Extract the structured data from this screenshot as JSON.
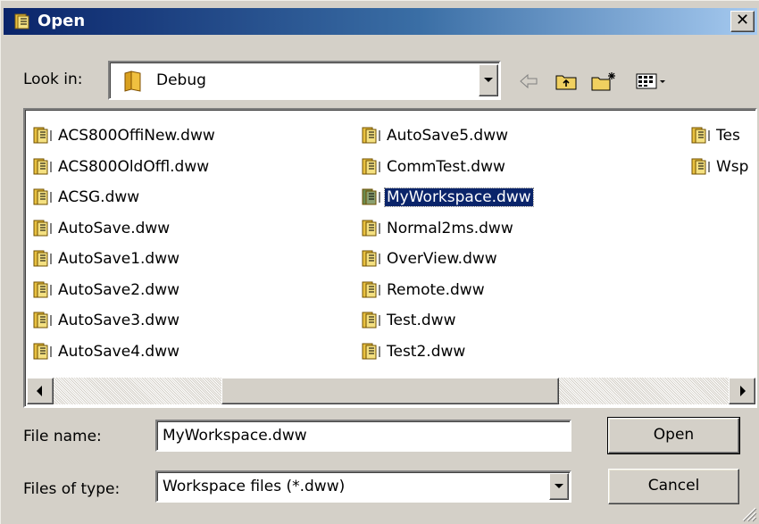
{
  "window": {
    "title": "Open",
    "close_glyph": "✕"
  },
  "lookin": {
    "label": "Look in:",
    "value": "Debug"
  },
  "toolbar": {
    "icons": [
      "back-arrow-icon",
      "up-folder-icon",
      "new-folder-icon",
      "view-menu-icon"
    ]
  },
  "files": {
    "col1": [
      "ACS800OffiNew.dww",
      "ACS800OldOffl.dww",
      "ACSG.dww",
      "AutoSave.dww",
      "AutoSave1.dww",
      "AutoSave2.dww",
      "AutoSave3.dww",
      "AutoSave4.dww"
    ],
    "col2": [
      "AutoSave5.dww",
      "CommTest.dww",
      "MyWorkspace.dww",
      "Normal2ms.dww",
      "OverView.dww",
      "Remote.dww",
      "Test.dww",
      "Test2.dww"
    ],
    "col3": [
      "Tes",
      "Wsp"
    ],
    "selected": "MyWorkspace.dww"
  },
  "filename": {
    "label": "File name:",
    "value": "MyWorkspace.dww"
  },
  "filetype": {
    "label": "Files of type:",
    "value": "Workspace files (*.dww)"
  },
  "buttons": {
    "open": "Open",
    "cancel": "Cancel"
  },
  "colors": {
    "title_gradient_start": "#0a246a",
    "title_gradient_end": "#a6caf0",
    "selection": "#0a246a",
    "face": "#d4d0c8"
  }
}
